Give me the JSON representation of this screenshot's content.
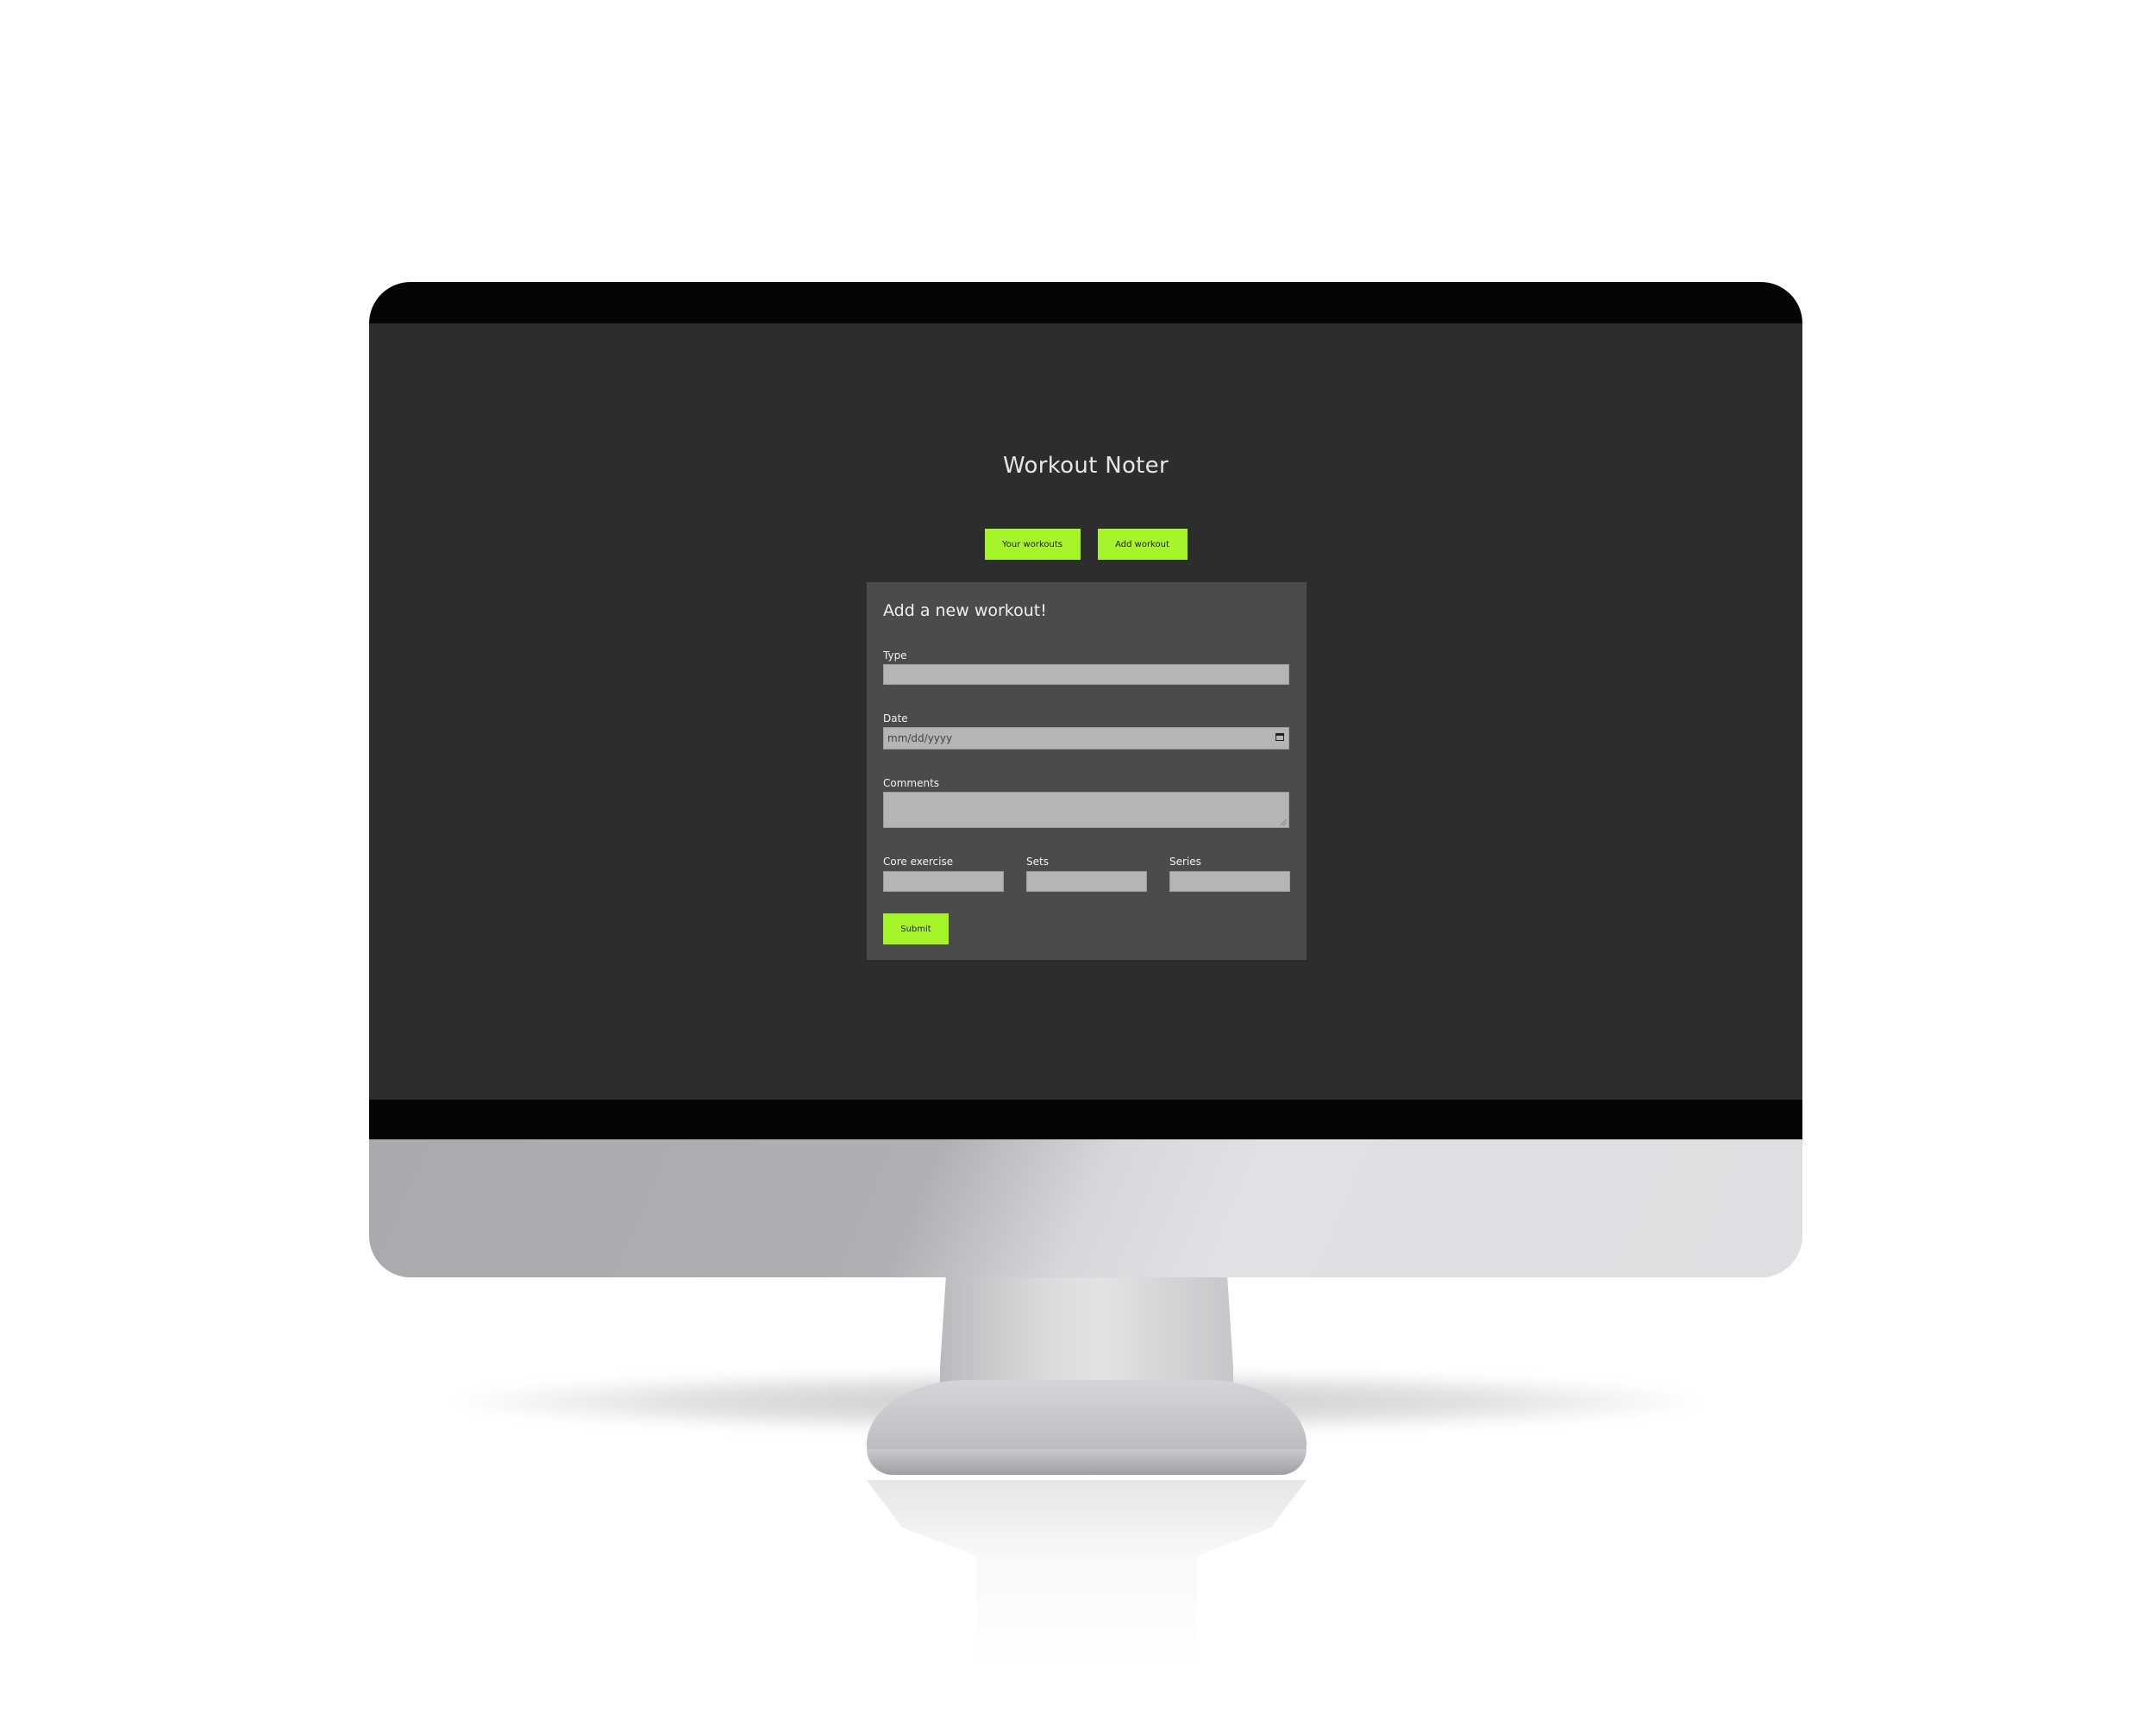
{
  "app": {
    "title": "Workout Noter"
  },
  "nav": {
    "your_workouts": "Your workouts",
    "add_workout": "Add workout"
  },
  "form": {
    "title": "Add a new workout!",
    "type_label": "Type",
    "type_value": "",
    "date_label": "Date",
    "date_placeholder": "mm/dd/yyyy",
    "comments_label": "Comments",
    "comments_value": "",
    "core_exercise_label": "Core exercise",
    "sets_label": "Sets",
    "series_label": "Series",
    "submit_label": "Submit"
  },
  "colors": {
    "accent": "#a6f52b",
    "background": "#2d2d2d",
    "card": "#4b4b4b",
    "field": "#b5b5b5"
  },
  "icons": {
    "date_picker": "calendar-icon",
    "comments_resize": "resize-handle-icon"
  }
}
